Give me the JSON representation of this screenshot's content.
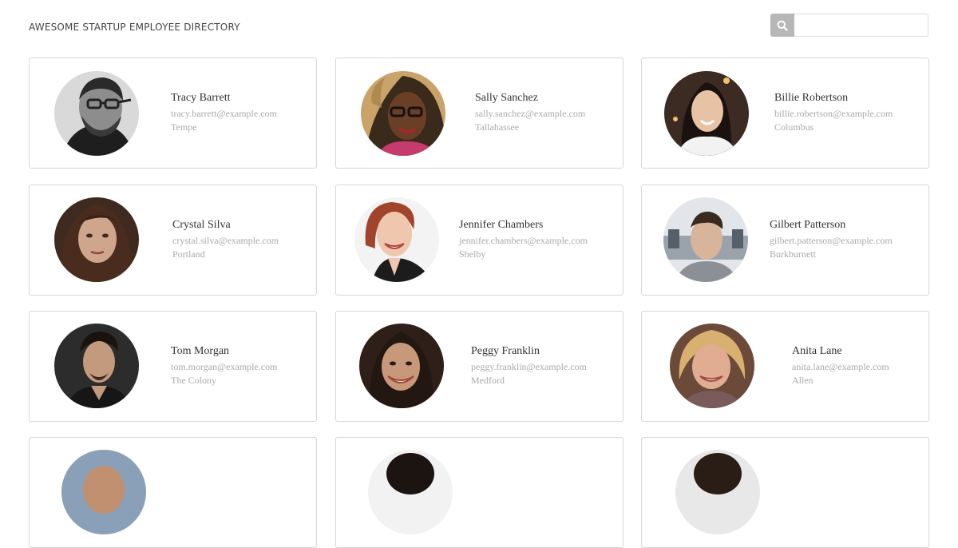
{
  "header": {
    "title": "AWESOME STARTUP EMPLOYEE DIRECTORY"
  },
  "search": {
    "placeholder": "",
    "value": ""
  },
  "employees": [
    {
      "name": "Tracy Barrett",
      "email": "tracy.barrett@example.com",
      "city": "Tempe"
    },
    {
      "name": "Sally Sanchez",
      "email": "sally.sanchez@example.com",
      "city": "Tallahassee"
    },
    {
      "name": "Billie Robertson",
      "email": "billie.robertson@example.com",
      "city": "Columbus"
    },
    {
      "name": "Crystal Silva",
      "email": "crystal.silva@example.com",
      "city": "Portland"
    },
    {
      "name": "Jennifer Chambers",
      "email": "jennifer.chambers@example.com",
      "city": "Shelby"
    },
    {
      "name": "Gilbert Patterson",
      "email": "gilbert.patterson@example.com",
      "city": "Burkburnett"
    },
    {
      "name": "Tom Morgan",
      "email": "tom.morgan@example.com",
      "city": "The Colony"
    },
    {
      "name": "Peggy Franklin",
      "email": "peggy.franklin@example.com",
      "city": "Medford"
    },
    {
      "name": "Anita Lane",
      "email": "anita.lane@example.com",
      "city": "Allen"
    },
    {
      "name": "",
      "email": "",
      "city": ""
    },
    {
      "name": "",
      "email": "",
      "city": ""
    },
    {
      "name": "",
      "email": "",
      "city": ""
    }
  ],
  "colors": {
    "card_border": "#d6d6d6",
    "search_button": "#b7b7b7",
    "muted_text": "#aaaaaa"
  },
  "icons": {
    "search": "search-icon"
  }
}
